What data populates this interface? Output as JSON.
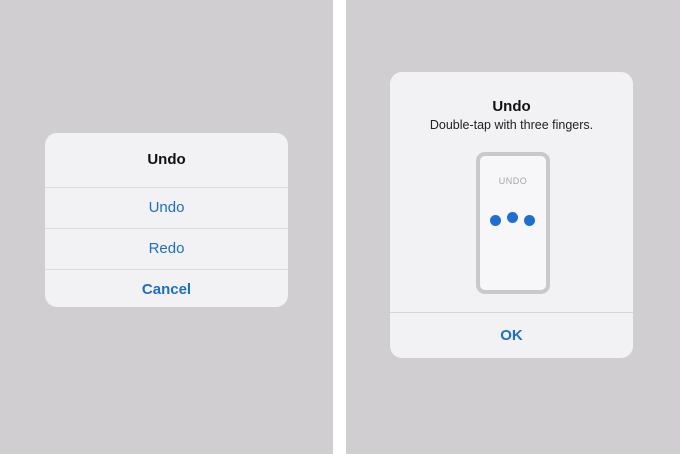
{
  "action_sheet": {
    "title": "Undo",
    "items": [
      {
        "label": "Undo"
      },
      {
        "label": "Redo"
      }
    ],
    "cancel_label": "Cancel"
  },
  "alert": {
    "title": "Undo",
    "message": "Double-tap with three fingers.",
    "illustration_label": "UNDO",
    "ok_label": "OK"
  },
  "colors": {
    "background": "#d0ced0",
    "sheet": "#f2f1f3",
    "accent": "#1d6fc2",
    "dot": "#1f6fd0"
  }
}
